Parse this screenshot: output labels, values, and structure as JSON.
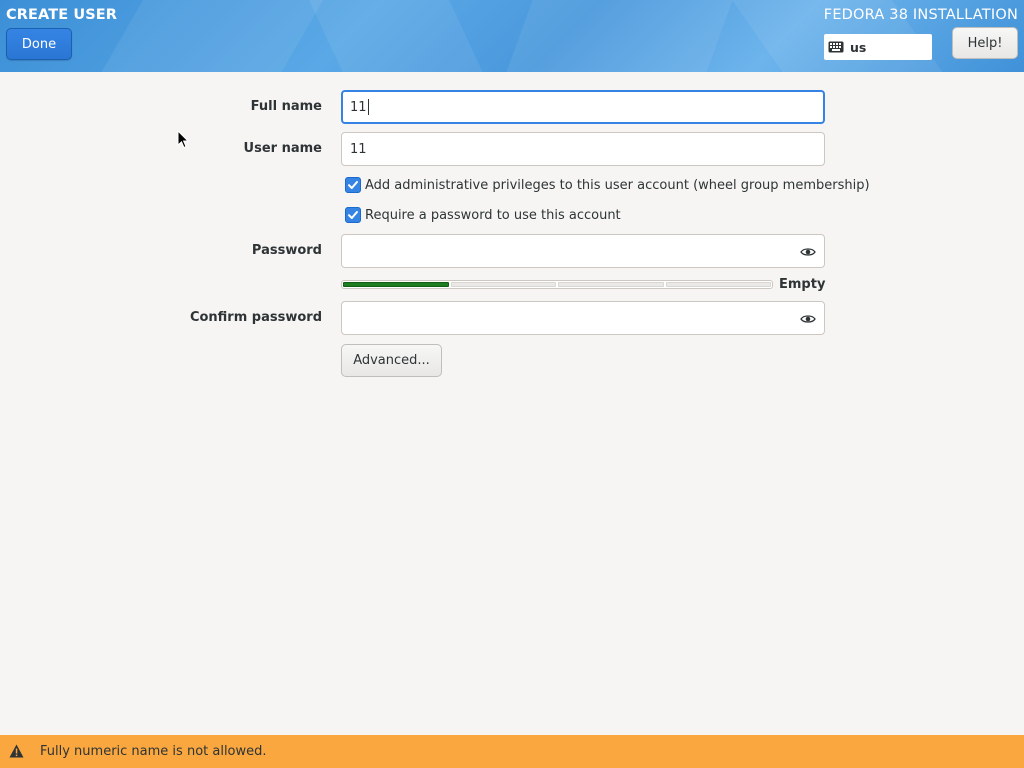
{
  "header": {
    "spoke_title": "CREATE USER",
    "done_label": "Done",
    "product_title": "FEDORA 38 INSTALLATION",
    "keyboard_layout": "us",
    "keyboard_icon": "keyboard-icon",
    "help_label": "Help!",
    "accent_color": "#3584e4"
  },
  "form": {
    "full_name": {
      "label": "Full name",
      "value": "11"
    },
    "user_name": {
      "label": "User name",
      "value": "11"
    },
    "admin_checkbox": {
      "label": "Add administrative privileges to this user account (wheel group membership)",
      "checked": true
    },
    "require_password_checkbox": {
      "label": "Require a password to use this account",
      "checked": true
    },
    "password": {
      "label": "Password",
      "value": "",
      "reveal_icon": "eye-icon"
    },
    "strength": {
      "label": "Empty",
      "level": 0.25,
      "color": "#1e7d1e"
    },
    "confirm_password": {
      "label": "Confirm password",
      "value": "",
      "reveal_icon": "eye-icon"
    },
    "advanced_label": "Advanced..."
  },
  "status": {
    "message": "Fully numeric name is not allowed.",
    "icon": "warning-icon",
    "color": "#f9a73e"
  }
}
